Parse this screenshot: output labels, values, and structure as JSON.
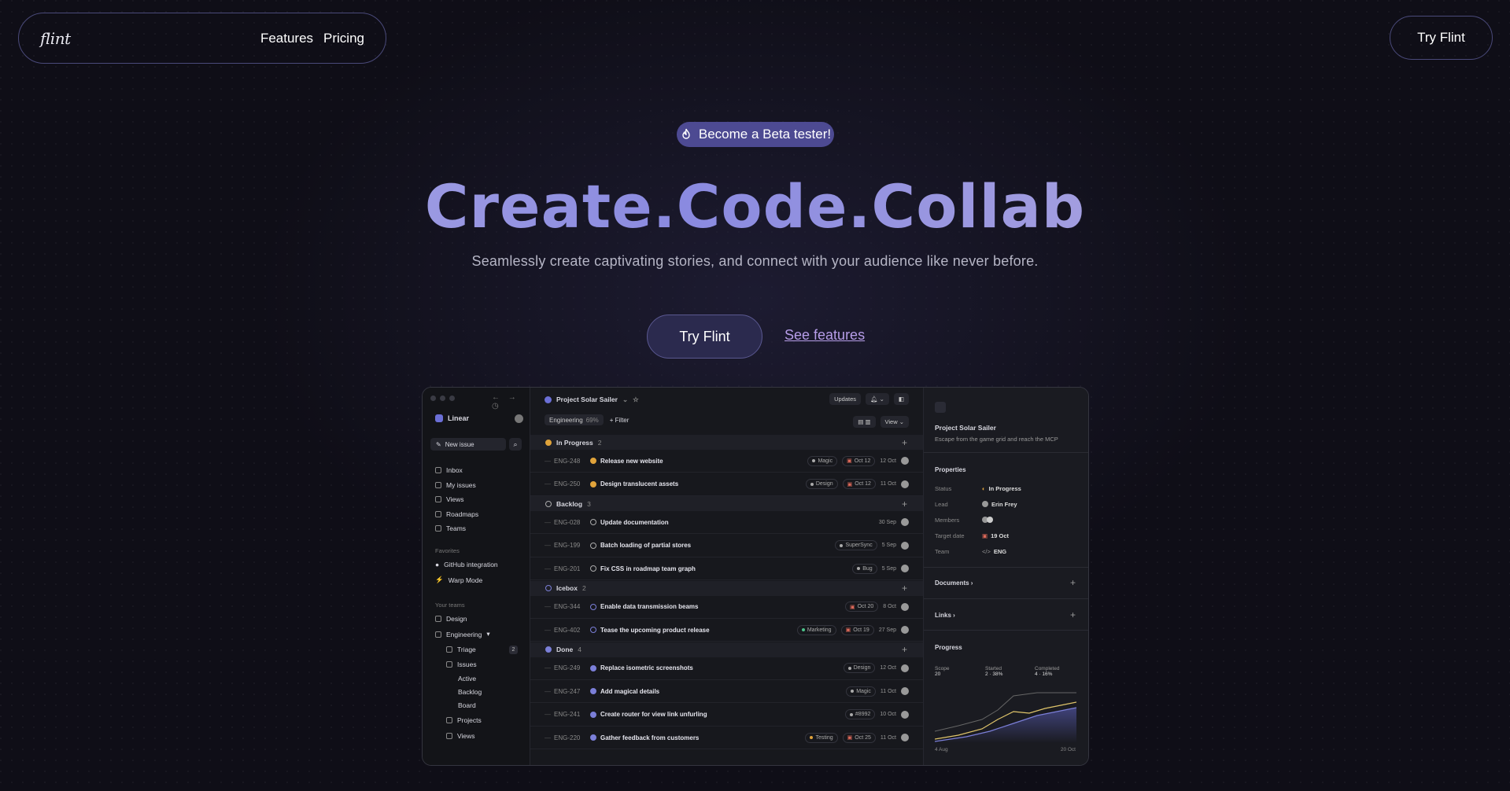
{
  "nav": {
    "logo": "flint",
    "links": [
      "Features",
      "Pricing"
    ],
    "cta": "Try Flint"
  },
  "hero": {
    "badge": "Become a Beta tester!",
    "headline": "Create.Code.Collab",
    "subtitle": "Seamlessly create captivating stories, and connect with your audience like never before.",
    "primary_cta": "Try Flint",
    "secondary_cta": "See features"
  },
  "app": {
    "workspace": "Linear",
    "new_issue": "New issue",
    "nav_items": [
      "Inbox",
      "My issues",
      "Views",
      "Roadmaps",
      "Teams"
    ],
    "favorites_label": "Favorites",
    "favorites": [
      "GitHub integration",
      "Warp Mode"
    ],
    "teams_label": "Your teams",
    "teams": [
      "Design",
      "Engineering"
    ],
    "engineering_items": [
      "Triage",
      "Issues",
      "Active",
      "Backlog",
      "Board",
      "Projects",
      "Views"
    ],
    "triage_count": "2",
    "project": "Project Solar Sailer",
    "updates_btn": "Updates",
    "view_btn": "View",
    "filter_team": "Engineering",
    "filter_pct": "69%",
    "filter_label": "Filter",
    "groups": [
      {
        "name": "In Progress",
        "count": "2",
        "color": "#e0a33b",
        "rows": [
          {
            "id": "ENG-248",
            "title": "Release new website",
            "tag": "Magic",
            "tagColor": "#aaaaaa",
            "due": "Oct 12",
            "date": "12 Oct"
          },
          {
            "id": "ENG-250",
            "title": "Design translucent assets",
            "tag": "Design",
            "tagColor": "#aaaaaa",
            "due": "Oct 12",
            "date": "11 Oct"
          }
        ]
      },
      {
        "name": "Backlog",
        "count": "3",
        "color": "#aaaaaa",
        "rows": [
          {
            "id": "ENG-028",
            "title": "Update documentation",
            "tag": "",
            "tagColor": "",
            "due": "",
            "date": "30 Sep"
          },
          {
            "id": "ENG-199",
            "title": "Batch loading of partial stores",
            "tag": "SuperSync",
            "tagColor": "#aaaaaa",
            "due": "",
            "date": "5 Sep"
          },
          {
            "id": "ENG-201",
            "title": "Fix CSS in roadmap team graph",
            "tag": "Bug",
            "tagColor": "#aaaaaa",
            "due": "",
            "date": "5 Sep"
          }
        ]
      },
      {
        "name": "Icebox",
        "count": "2",
        "color": "#7b7fd8",
        "rows": [
          {
            "id": "ENG-344",
            "title": "Enable data transmission beams",
            "tag": "",
            "tagColor": "",
            "due": "Oct 20",
            "date": "8 Oct"
          },
          {
            "id": "ENG-402",
            "title": "Tease the upcoming product release",
            "tag": "Marketing",
            "tagColor": "#4cc28a",
            "due": "Oct 19",
            "date": "27 Sep"
          }
        ]
      },
      {
        "name": "Done",
        "count": "4",
        "color": "#7b7fd8",
        "rows": [
          {
            "id": "ENG-249",
            "title": "Replace isometric screenshots",
            "tag": "Design",
            "tagColor": "#aaaaaa",
            "due": "",
            "date": "12 Oct"
          },
          {
            "id": "ENG-247",
            "title": "Add magical details",
            "tag": "Magic",
            "tagColor": "#aaaaaa",
            "due": "",
            "date": "11 Oct"
          },
          {
            "id": "ENG-241",
            "title": "Create router for view link unfurling",
            "tag": "#8992",
            "tagColor": "#aaaaaa",
            "due": "",
            "date": "10 Oct"
          },
          {
            "id": "ENG-220",
            "title": "Gather feedback from customers",
            "tag": "Testing",
            "tagColor": "#e0a33b",
            "due": "Oct 25",
            "date": "11 Oct"
          }
        ]
      }
    ],
    "panel": {
      "title": "Project Solar Sailer",
      "desc": "Escape from the game grid and reach the MCP",
      "properties_label": "Properties",
      "props": [
        {
          "k": "Status",
          "v": "In Progress"
        },
        {
          "k": "Lead",
          "v": "Erin Frey"
        },
        {
          "k": "Members",
          "v": ""
        },
        {
          "k": "Target date",
          "v": "19 Oct"
        },
        {
          "k": "Team",
          "v": "ENG"
        }
      ],
      "documents": "Documents",
      "links": "Links",
      "progress": "Progress",
      "legend": [
        {
          "label": "Scope",
          "value": "20"
        },
        {
          "label": "Started",
          "value": "2 · 38%"
        },
        {
          "label": "Completed",
          "value": "4 · 16%"
        }
      ],
      "axis_start": "4 Aug",
      "axis_end": "20 Oct"
    }
  }
}
